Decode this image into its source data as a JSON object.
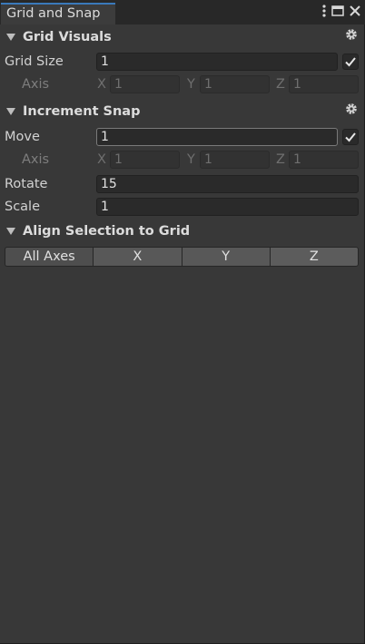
{
  "window": {
    "tab_title": "Grid and Snap",
    "icons": [
      "kebab-menu-icon",
      "maximize-icon",
      "close-icon"
    ]
  },
  "grid_visuals": {
    "title": "Grid Visuals",
    "grid_size_label": "Grid Size",
    "grid_size_value": "1",
    "grid_size_linked": true,
    "axis_label": "Axis",
    "axis": {
      "x_label": "X",
      "x": "1",
      "y_label": "Y",
      "y": "1",
      "z_label": "Z",
      "z": "1"
    }
  },
  "increment_snap": {
    "title": "Increment Snap",
    "move_label": "Move",
    "move_value": "1",
    "move_linked": true,
    "axis_label": "Axis",
    "axis": {
      "x_label": "X",
      "x": "1",
      "y_label": "Y",
      "y": "1",
      "z_label": "Z",
      "z": "1"
    },
    "rotate_label": "Rotate",
    "rotate_value": "15",
    "scale_label": "Scale",
    "scale_value": "1"
  },
  "align": {
    "title": "Align Selection to Grid",
    "buttons": [
      "All Axes",
      "X",
      "Y",
      "Z"
    ]
  }
}
